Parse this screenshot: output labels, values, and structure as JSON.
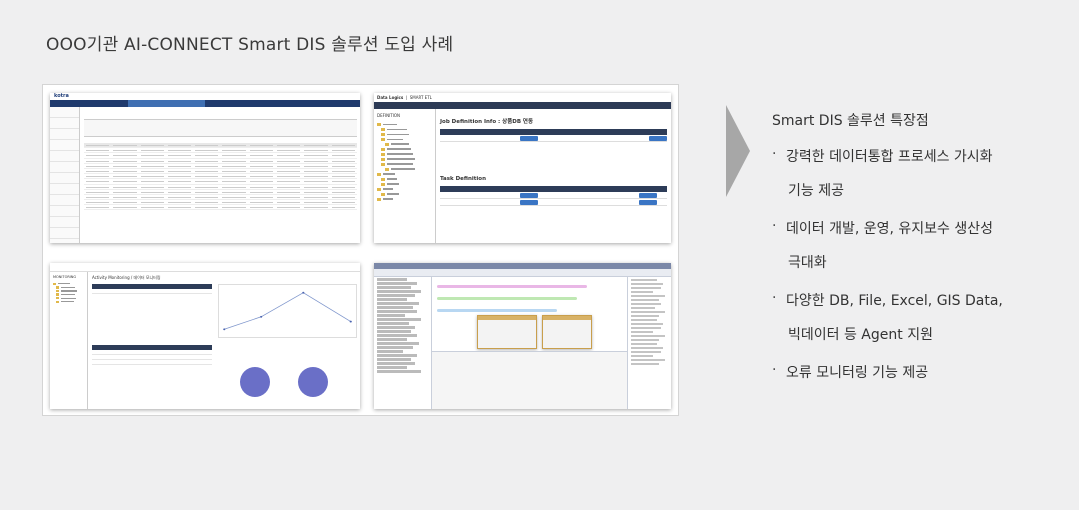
{
  "page": {
    "title": "OOO기관 AI-CONNECT Smart DIS 솔루션 도입 사례"
  },
  "screenshots": {
    "shot1": {
      "brand": "kotra"
    },
    "shot2": {
      "brand": "Data Logics",
      "product": "SMART ETL",
      "tree_header": "DEFINITION",
      "section1": "Job Definition Info : 상품DB 연동",
      "section2": "Task Definition"
    },
    "shot3": {
      "tree_header": "MONITORING",
      "title": "Activity Monitoring / 데이터 모니터링"
    }
  },
  "features": {
    "title": "Smart DIS 솔루션 특장점",
    "items": [
      {
        "bullet": "·",
        "line1": "강력한 데이터통합 프로세스 가시화",
        "line2": "기능 제공"
      },
      {
        "bullet": "·",
        "line1": "데이터 개발, 운영, 유지보수 생산성",
        "line2": "극대화"
      },
      {
        "bullet": "·",
        "line1": "다양한 DB, File, Excel, GIS Data,",
        "line2": "빅데이터 등 Agent 지원"
      },
      {
        "bullet": "·",
        "line1": "오류 모니터링 기능 제공",
        "line2": ""
      }
    ]
  },
  "colors": {
    "background": "#efeff0",
    "arrow": "#a7a7a7",
    "navy": "#1f3a6d"
  }
}
